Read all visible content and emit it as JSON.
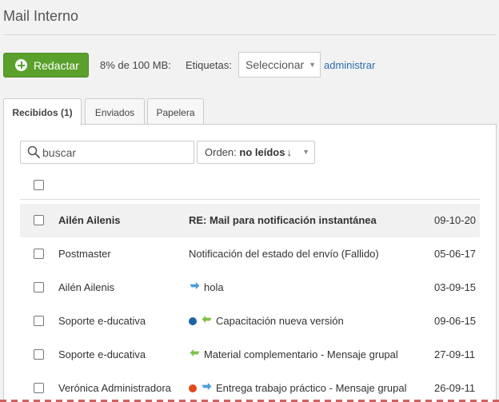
{
  "page": {
    "title": "Mail Interno"
  },
  "toolbar": {
    "compose_label": "Redactar",
    "quota": "8% de 100 MB:",
    "labels_caption": "Etiquetas:",
    "labels_select_value": "Seleccionar",
    "admin_link": "administrar"
  },
  "tabs": [
    {
      "label": "Recibidos (1)",
      "active": true
    },
    {
      "label": "Enviados",
      "active": false
    },
    {
      "label": "Papelera",
      "active": false
    }
  ],
  "search": {
    "placeholder": "buscar",
    "value": ""
  },
  "order": {
    "prefix": "Orden:",
    "value": "no leídos",
    "direction_glyph": "↓"
  },
  "colors": {
    "accent_green": "#5aa02c",
    "link_blue": "#2a6db0",
    "reply_arrow": "#4a9fe0",
    "forward_arrow": "#7cc24a",
    "label_blue": "#1d63a8",
    "label_orange": "#e04a1a"
  },
  "messages": [
    {
      "sender": "Ailén Ailenis",
      "subject": "RE: Mail para notificación instantánea",
      "date": "09-10-20",
      "unread": true,
      "label_color": null,
      "icon": null
    },
    {
      "sender": "Postmaster",
      "subject": "Notificación del estado del envío (Fallido)",
      "date": "05-06-17",
      "unread": false,
      "label_color": null,
      "icon": null
    },
    {
      "sender": "Ailén Ailenis",
      "subject": "hola",
      "date": "03-09-15",
      "unread": false,
      "label_color": null,
      "icon": "reply-arrow-icon"
    },
    {
      "sender": "Soporte e-ducativa",
      "subject": "Capacitación nueva versión",
      "date": "09-06-15",
      "unread": false,
      "label_color": "#1d63a8",
      "icon": "forward-arrow-icon"
    },
    {
      "sender": "Soporte e-ducativa",
      "subject": "Material complementario - Mensaje grupal",
      "date": "27-09-11",
      "unread": false,
      "label_color": null,
      "icon": "forward-arrow-icon"
    },
    {
      "sender": "Verónica Administradora",
      "subject": "Entrega trabajo práctico - Mensaje grupal",
      "date": "26-09-11",
      "unread": false,
      "label_color": "#e04a1a",
      "icon": "reply-arrow-icon"
    }
  ]
}
